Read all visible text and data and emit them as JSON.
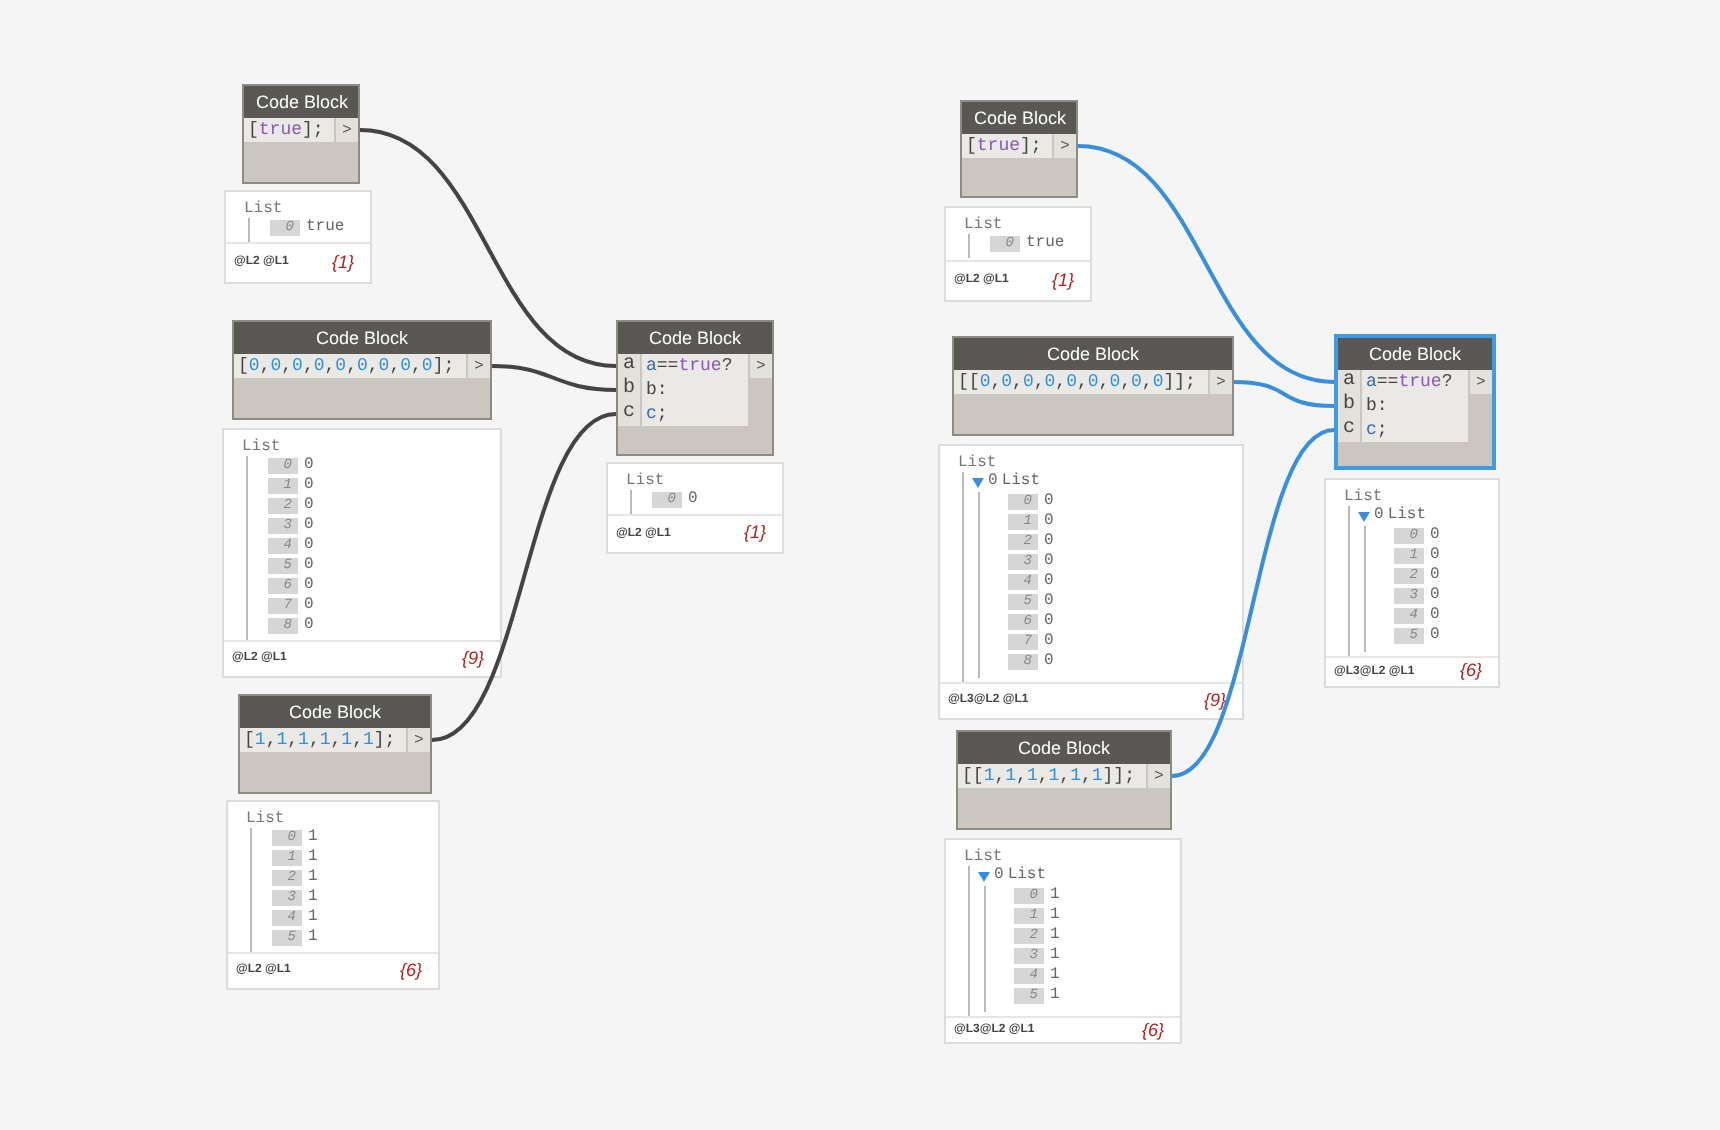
{
  "graphs": [
    {
      "nodes": [
        {
          "title": "Code Block",
          "selected": false,
          "code": [
            [
              {
                "t": "[",
                "kind": "plain"
              },
              {
                "t": "true",
                "kind": "keyword"
              },
              {
                "t": "];",
                "kind": "plain"
              }
            ]
          ],
          "output": ">",
          "preview": {
            "header": "List",
            "items": [
              {
                "index": "0",
                "value": "true"
              }
            ],
            "levels": "@L2 @L1",
            "count": "{1}"
          }
        },
        {
          "title": "Code Block",
          "selected": false,
          "code": [
            [
              {
                "t": "[",
                "kind": "plain"
              },
              {
                "t": "0",
                "kind": "number"
              },
              {
                "t": ",",
                "kind": "plain"
              },
              {
                "t": "0",
                "kind": "number"
              },
              {
                "t": ",",
                "kind": "plain"
              },
              {
                "t": "0",
                "kind": "number"
              },
              {
                "t": ",",
                "kind": "plain"
              },
              {
                "t": "0",
                "kind": "number"
              },
              {
                "t": ",",
                "kind": "plain"
              },
              {
                "t": "0",
                "kind": "number"
              },
              {
                "t": ",",
                "kind": "plain"
              },
              {
                "t": "0",
                "kind": "number"
              },
              {
                "t": ",",
                "kind": "plain"
              },
              {
                "t": "0",
                "kind": "number"
              },
              {
                "t": ",",
                "kind": "plain"
              },
              {
                "t": "0",
                "kind": "number"
              },
              {
                "t": ",",
                "kind": "plain"
              },
              {
                "t": "0",
                "kind": "number"
              },
              {
                "t": "];",
                "kind": "plain"
              }
            ]
          ],
          "output": ">",
          "preview": {
            "header": "List",
            "items": [
              {
                "index": "0",
                "value": "0"
              },
              {
                "index": "1",
                "value": "0"
              },
              {
                "index": "2",
                "value": "0"
              },
              {
                "index": "3",
                "value": "0"
              },
              {
                "index": "4",
                "value": "0"
              },
              {
                "index": "5",
                "value": "0"
              },
              {
                "index": "6",
                "value": "0"
              },
              {
                "index": "7",
                "value": "0"
              },
              {
                "index": "8",
                "value": "0"
              }
            ],
            "levels": "@L2 @L1",
            "count": "{9}"
          }
        },
        {
          "title": "Code Block",
          "selected": false,
          "code": [
            [
              {
                "t": "[",
                "kind": "plain"
              },
              {
                "t": "1",
                "kind": "number"
              },
              {
                "t": ",",
                "kind": "plain"
              },
              {
                "t": "1",
                "kind": "number"
              },
              {
                "t": ",",
                "kind": "plain"
              },
              {
                "t": "1",
                "kind": "number"
              },
              {
                "t": ",",
                "kind": "plain"
              },
              {
                "t": "1",
                "kind": "number"
              },
              {
                "t": ",",
                "kind": "plain"
              },
              {
                "t": "1",
                "kind": "number"
              },
              {
                "t": ",",
                "kind": "plain"
              },
              {
                "t": "1",
                "kind": "number"
              },
              {
                "t": "];",
                "kind": "plain"
              }
            ]
          ],
          "output": ">",
          "preview": {
            "header": "List",
            "items": [
              {
                "index": "0",
                "value": "1"
              },
              {
                "index": "1",
                "value": "1"
              },
              {
                "index": "2",
                "value": "1"
              },
              {
                "index": "3",
                "value": "1"
              },
              {
                "index": "4",
                "value": "1"
              },
              {
                "index": "5",
                "value": "1"
              }
            ],
            "levels": "@L2 @L1",
            "count": "{6}"
          }
        },
        {
          "title": "Code Block",
          "selected": false,
          "inputs": [
            "a",
            "b",
            "c"
          ],
          "code": [
            [
              {
                "t": "a",
                "kind": "variable"
              },
              {
                "t": "==",
                "kind": "plain"
              },
              {
                "t": "true",
                "kind": "keyword"
              },
              {
                "t": "?",
                "kind": "plain"
              }
            ],
            [
              {
                "t": "b:",
                "kind": "plain"
              }
            ],
            [
              {
                "t": "c",
                "kind": "variable"
              },
              {
                "t": ";",
                "kind": "plain"
              }
            ]
          ],
          "output": ">",
          "preview": {
            "header": "List",
            "items": [
              {
                "index": "0",
                "value": "0"
              }
            ],
            "levels": "@L2 @L1",
            "count": "{1}"
          }
        }
      ],
      "wires": [
        {
          "color": "#444444"
        },
        {
          "color": "#444444"
        },
        {
          "color": "#444444"
        }
      ]
    },
    {
      "nodes": [
        {
          "title": "Code Block",
          "selected": false,
          "code": [
            [
              {
                "t": "[",
                "kind": "plain"
              },
              {
                "t": "true",
                "kind": "keyword"
              },
              {
                "t": "];",
                "kind": "plain"
              }
            ]
          ],
          "output": ">",
          "preview": {
            "header": "List",
            "items": [
              {
                "index": "0",
                "value": "true"
              }
            ],
            "levels": "@L2 @L1",
            "count": "{1}"
          }
        },
        {
          "title": "Code Block",
          "selected": false,
          "code": [
            [
              {
                "t": "[[",
                "kind": "plain"
              },
              {
                "t": "0",
                "kind": "number"
              },
              {
                "t": ",",
                "kind": "plain"
              },
              {
                "t": "0",
                "kind": "number"
              },
              {
                "t": ",",
                "kind": "plain"
              },
              {
                "t": "0",
                "kind": "number"
              },
              {
                "t": ",",
                "kind": "plain"
              },
              {
                "t": "0",
                "kind": "number"
              },
              {
                "t": ",",
                "kind": "plain"
              },
              {
                "t": "0",
                "kind": "number"
              },
              {
                "t": ",",
                "kind": "plain"
              },
              {
                "t": "0",
                "kind": "number"
              },
              {
                "t": ",",
                "kind": "plain"
              },
              {
                "t": "0",
                "kind": "number"
              },
              {
                "t": ",",
                "kind": "plain"
              },
              {
                "t": "0",
                "kind": "number"
              },
              {
                "t": ",",
                "kind": "plain"
              },
              {
                "t": "0",
                "kind": "number"
              },
              {
                "t": "]];",
                "kind": "plain"
              }
            ]
          ],
          "output": ">",
          "preview": {
            "header": "List",
            "items": [
              {
                "index": "0",
                "label": "List",
                "expanded": true,
                "children": [
                  {
                    "index": "0",
                    "value": "0"
                  },
                  {
                    "index": "1",
                    "value": "0"
                  },
                  {
                    "index": "2",
                    "value": "0"
                  },
                  {
                    "index": "3",
                    "value": "0"
                  },
                  {
                    "index": "4",
                    "value": "0"
                  },
                  {
                    "index": "5",
                    "value": "0"
                  },
                  {
                    "index": "6",
                    "value": "0"
                  },
                  {
                    "index": "7",
                    "value": "0"
                  },
                  {
                    "index": "8",
                    "value": "0"
                  }
                ]
              }
            ],
            "levels": "@L3@L2 @L1",
            "count": "{9}"
          }
        },
        {
          "title": "Code Block",
          "selected": false,
          "code": [
            [
              {
                "t": "[[",
                "kind": "plain"
              },
              {
                "t": "1",
                "kind": "number"
              },
              {
                "t": ",",
                "kind": "plain"
              },
              {
                "t": "1",
                "kind": "number"
              },
              {
                "t": ",",
                "kind": "plain"
              },
              {
                "t": "1",
                "kind": "number"
              },
              {
                "t": ",",
                "kind": "plain"
              },
              {
                "t": "1",
                "kind": "number"
              },
              {
                "t": ",",
                "kind": "plain"
              },
              {
                "t": "1",
                "kind": "number"
              },
              {
                "t": ",",
                "kind": "plain"
              },
              {
                "t": "1",
                "kind": "number"
              },
              {
                "t": "]];",
                "kind": "plain"
              }
            ]
          ],
          "output": ">",
          "preview": {
            "header": "List",
            "items": [
              {
                "index": "0",
                "label": "List",
                "expanded": true,
                "children": [
                  {
                    "index": "0",
                    "value": "1"
                  },
                  {
                    "index": "1",
                    "value": "1"
                  },
                  {
                    "index": "2",
                    "value": "1"
                  },
                  {
                    "index": "3",
                    "value": "1"
                  },
                  {
                    "index": "4",
                    "value": "1"
                  },
                  {
                    "index": "5",
                    "value": "1"
                  }
                ]
              }
            ],
            "levels": "@L3@L2 @L1",
            "count": "{6}"
          }
        },
        {
          "title": "Code Block",
          "selected": true,
          "inputs": [
            "a",
            "b",
            "c"
          ],
          "code": [
            [
              {
                "t": "a",
                "kind": "variable"
              },
              {
                "t": "==",
                "kind": "plain"
              },
              {
                "t": "true",
                "kind": "keyword"
              },
              {
                "t": "?",
                "kind": "plain"
              }
            ],
            [
              {
                "t": "b:",
                "kind": "plain"
              }
            ],
            [
              {
                "t": "c",
                "kind": "variable"
              },
              {
                "t": ";",
                "kind": "plain"
              }
            ]
          ],
          "output": ">",
          "preview": {
            "header": "List",
            "items": [
              {
                "index": "0",
                "label": "List",
                "expanded": true,
                "children": [
                  {
                    "index": "0",
                    "value": "0"
                  },
                  {
                    "index": "1",
                    "value": "0"
                  },
                  {
                    "index": "2",
                    "value": "0"
                  },
                  {
                    "index": "3",
                    "value": "0"
                  },
                  {
                    "index": "4",
                    "value": "0"
                  },
                  {
                    "index": "5",
                    "value": "0"
                  }
                ]
              }
            ],
            "levels": "@L3@L2 @L1",
            "count": "{6}"
          }
        }
      ],
      "wires": [
        {
          "color": "#3a8fdc"
        },
        {
          "color": "#3a8fdc"
        },
        {
          "color": "#3a8fdc"
        }
      ]
    }
  ]
}
